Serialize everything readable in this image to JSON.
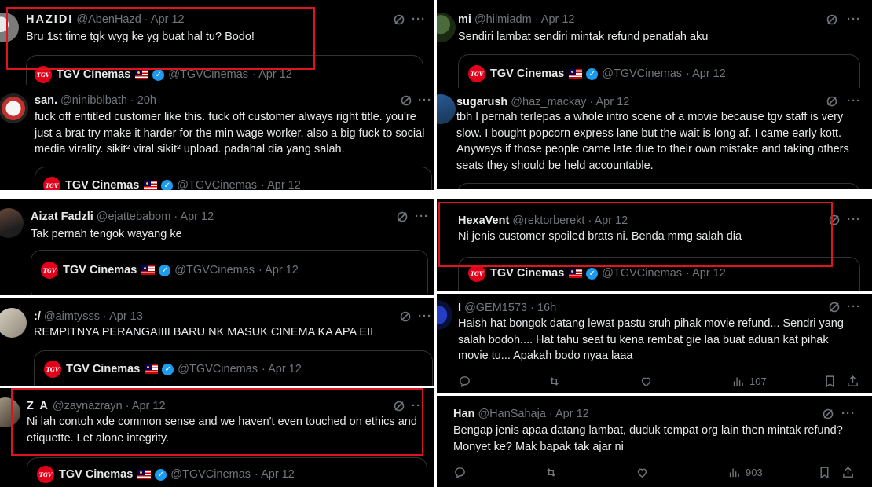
{
  "quoted": {
    "name": "TGV Cinemas",
    "handle": "@TGVCinemas",
    "date": "· Apr 12",
    "logo_text": "TGV"
  },
  "left": [
    {
      "name": "HAZIDI",
      "meta": "@AbenHazd · Apr 12",
      "text": "Bru 1st time tgk wyg ke yg buat hal tu? Bodo!"
    },
    {
      "name": "san.",
      "meta": "@ninibblbath · 20h",
      "text": "fuck off entitled customer like this. fuck off customer always right title. you're just a brat try make it harder for the min wage worker. also a big fuck to social media virality. sikit² viral sikit² upload. padahal dia yang salah."
    },
    {
      "name": "Aizat Fadzli",
      "meta": "@ejattebabom · Apr 12",
      "text": "Tak pernah tengok wayang ke"
    },
    {
      "name": ":/",
      "meta": "@aimtysss · Apr 13",
      "text": "REMPITNYA PERANGAIIII BARU NK MASUK CINEMA KA APA EII"
    },
    {
      "name": "Z A",
      "meta": "@zaynazrayn · Apr 12",
      "text": "Ni lah contoh xde common sense and we haven't even touched on ethics and etiquette. Let alone integrity."
    }
  ],
  "right": [
    {
      "name": "mi",
      "meta": "@hilmiadm · Apr 12",
      "text": "Sendiri lambat sendiri mintak refund penatlah aku"
    },
    {
      "name": "sugarush",
      "meta": "@haz_mackay · Apr 12",
      "text": "tbh I pernah terlepas a whole intro scene of a movie because tgv staff is very slow. I bought popcorn express lane but the wait is long af. I came early kott. Anyways if those people came late due to their own mistake and taking others seats they should be held accountable."
    },
    {
      "name": "HexaVent",
      "meta": "@rektorberekt · Apr 12",
      "text": "Ni jenis customer spoiled brats ni. Benda mmg salah dia"
    },
    {
      "name": "I",
      "meta": "@GEM1573 · 16h",
      "text": "Haish hat bongok datang lewat pastu sruh pihak movie refund... Sendri yang salah bodoh.... Hat tahu seat tu kena rembat gie laa buat aduan kat pihak movie tu... Apakah bodo nyaa laaa",
      "views": "107"
    },
    {
      "name": "Han",
      "meta": "@HanSahaja · Apr 12",
      "text": "Bengap jenis apaa datang lambat, duduk tempat org lain then mintak refund? Monyet ke? Mak bapak tak ajar ni",
      "views": "903"
    }
  ],
  "colors": {
    "background": "#000000",
    "text": "#e7e9ea",
    "muted": "#71767b",
    "verified": "#1d9bf0",
    "highlight": "#e0141e",
    "tgv_red": "#e2001a"
  }
}
